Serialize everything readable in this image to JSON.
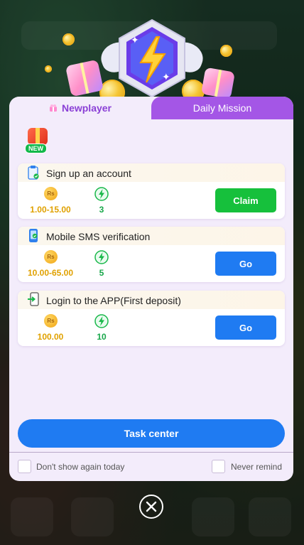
{
  "tabs": {
    "newplayer": "Newplayer",
    "daily_mission": "Daily Mission"
  },
  "badge": {
    "new_label": "NEW"
  },
  "tasks": [
    {
      "title": "Sign up an account",
      "currency": "Rs",
      "amount": "1.00-15.00",
      "energy": "3",
      "action": "Claim",
      "icon": "clipboard-check-icon"
    },
    {
      "title": "Mobile SMS verification",
      "currency": "Rs",
      "amount": "10.00-65.00",
      "energy": "5",
      "action": "Go",
      "icon": "phone-icon"
    },
    {
      "title": "Login to the APP(First deposit)",
      "currency": "Rs",
      "amount": "100.00",
      "energy": "10",
      "action": "Go",
      "icon": "login-device-icon"
    }
  ],
  "task_center": "Task center",
  "options": {
    "dont_show_today": "Don't show again today",
    "never_remind": "Never remind"
  },
  "colors": {
    "accent_purple": "#a456e6",
    "primary_blue": "#1f7bf2",
    "claim_green": "#16c03c",
    "amount_gold": "#e0a100",
    "energy_green": "#18a74a"
  }
}
